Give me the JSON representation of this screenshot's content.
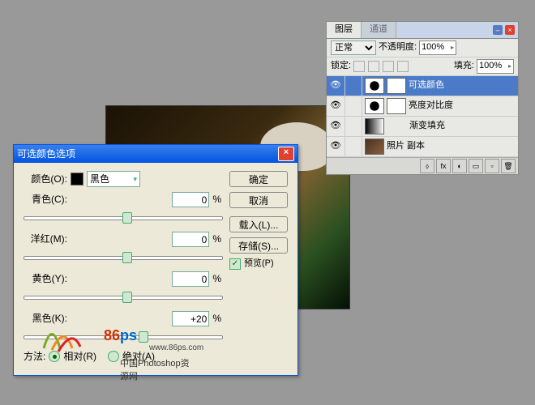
{
  "layers_panel": {
    "tabs": {
      "active": "图层",
      "inactive": "通道"
    },
    "blend_mode": "正常",
    "opacity_label": "不透明度:",
    "opacity_value": "100%",
    "lock_label": "锁定:",
    "fill_label": "填充:",
    "fill_value": "100%",
    "layers": [
      {
        "name": "可选颜色",
        "selected": true,
        "type": "adj"
      },
      {
        "name": "亮度对比度",
        "type": "adj"
      },
      {
        "name": "渐变填充",
        "type": "grad"
      },
      {
        "name": "照片 副本",
        "type": "img"
      }
    ]
  },
  "dialog": {
    "title": "可选颜色选项",
    "color_label": "颜色(O):",
    "color_value": "黑色",
    "sliders": [
      {
        "label": "青色(C):",
        "value": "0",
        "pos": 50
      },
      {
        "label": "洋红(M):",
        "value": "0",
        "pos": 50
      },
      {
        "label": "黄色(Y):",
        "value": "0",
        "pos": 50
      },
      {
        "label": "黑色(K):",
        "value": "+20",
        "pos": 58
      }
    ],
    "method_label": "方法:",
    "method_relative": "相对(R)",
    "method_absolute": "绝对(A)",
    "ok": "确定",
    "cancel": "取消",
    "load": "载入(L)...",
    "save": "存储(S)...",
    "preview": "预览(P)",
    "pct": "%"
  },
  "watermark": {
    "brand1": "86",
    "brand2": "ps",
    "url": "www.86ps.com",
    "caption": "中国Photoshop资源网"
  }
}
